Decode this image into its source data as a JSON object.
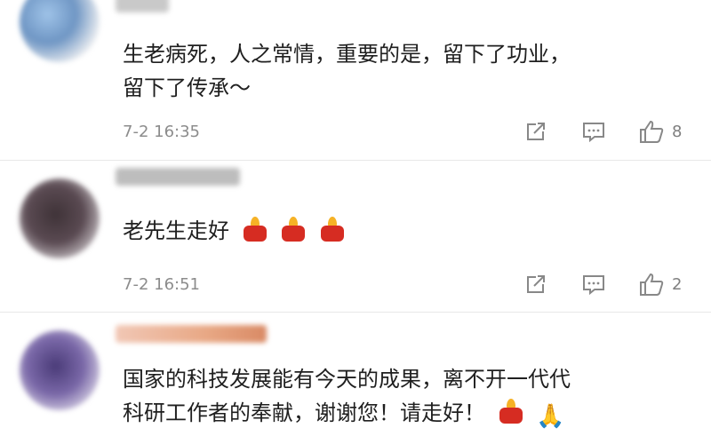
{
  "comments": [
    {
      "text_line1": "生老病死，人之常情，重要的是，留下了功业，",
      "text_line2": "留下了传承～",
      "time": "7-2 16:35",
      "likes": "8"
    },
    {
      "text": "老先生走好",
      "time": "7-2 16:51",
      "likes": "2"
    },
    {
      "text_line1": "国家的科技发展能有今天的成果，离不开一代代",
      "text_line2": "科研工作者的奉献，谢谢您！请走好！"
    }
  ],
  "icons": {
    "share": "share-icon",
    "reply": "comment-icon",
    "like": "thumbs-up-icon",
    "candle": "candle-emoji",
    "praying": "praying-hands-emoji"
  },
  "colors": {
    "text": "#1f1f1f",
    "meta": "#8c8c8c",
    "candle": "#d62c22"
  }
}
